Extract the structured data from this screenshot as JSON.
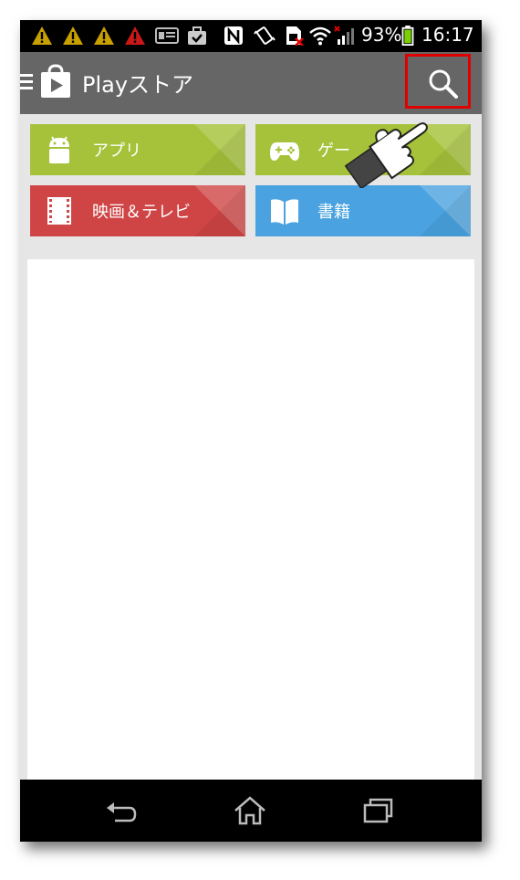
{
  "status_bar": {
    "battery": "93%",
    "time": "16:17",
    "icons": [
      "warning-icon",
      "warning-icon",
      "warning-icon",
      "warning-red-icon",
      "info-icon",
      "briefcase-icon",
      "nfc-icon",
      "vibrate-icon",
      "sim-icon",
      "wifi-icon",
      "signal-icon",
      "battery-icon"
    ]
  },
  "app_bar": {
    "title": "Playストア",
    "icons": [
      "menu-icon",
      "play-store-icon",
      "search-icon"
    ]
  },
  "tiles": [
    {
      "label": "アプリ",
      "color": "#a5c23a",
      "icon": "android-icon"
    },
    {
      "label": "ゲー",
      "color": "#a5c23a",
      "icon": "gamepad-icon"
    },
    {
      "label": "映画＆テレビ",
      "color": "#cf4545",
      "icon": "film-icon"
    },
    {
      "label": "書籍",
      "color": "#4aa3e0",
      "icon": "book-icon"
    }
  ],
  "highlight_color": "#e00000",
  "nav_bar": {
    "icons": [
      "back-icon",
      "home-icon",
      "recent-apps-icon"
    ]
  }
}
